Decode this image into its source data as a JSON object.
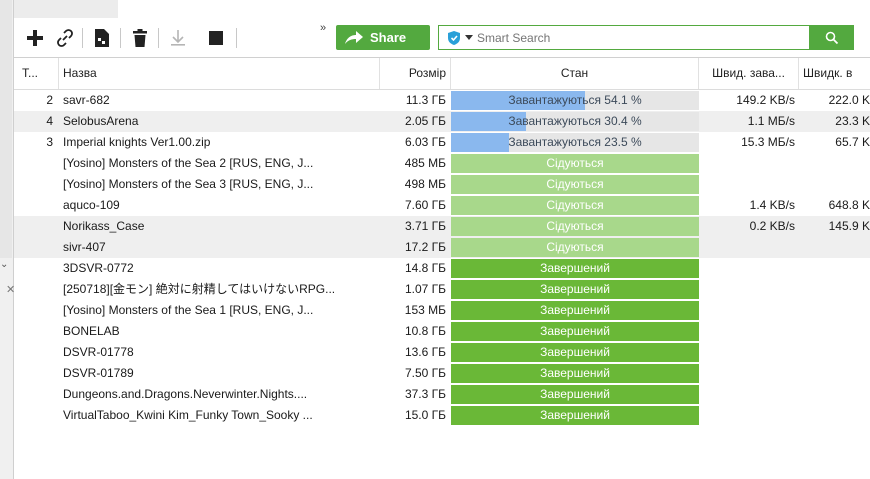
{
  "toolbar": {
    "share_label": "Share",
    "search_placeholder": "Smart Search",
    "overflow_label": "»"
  },
  "columns": {
    "num": "T...",
    "name": "Назва",
    "size": "Розмір",
    "status": "Стан",
    "down_speed": "Швид. зава...",
    "up_speed": "Швидк. в"
  },
  "rows": [
    {
      "num": "2",
      "name": "savr-682",
      "size": "11.3 ГБ",
      "status": "Завантажуються 54.1 %",
      "kind": "down",
      "progress": 0.541,
      "down": "149.2 KB/s",
      "up": "222.0 K"
    },
    {
      "num": "4",
      "name": "SelobusArena",
      "size": "2.05 ГБ",
      "status": "Завантажуються 30.4 %",
      "kind": "down",
      "progress": 0.304,
      "down": "1.1 МБ/s",
      "up": "23.3 K"
    },
    {
      "num": "3",
      "name": "Imperial knights Ver1.00.zip",
      "size": "6.03 ГБ",
      "status": "Завантажуються 23.5 %",
      "kind": "down",
      "progress": 0.235,
      "down": "15.3 МБ/s",
      "up": "65.7 K"
    },
    {
      "num": "",
      "name": "[Yosino] Monsters of the Sea 2 [RUS, ENG, J...",
      "size": "485 МБ",
      "status": "Сідуються",
      "kind": "seed",
      "progress": 1,
      "down": "",
      "up": ""
    },
    {
      "num": "",
      "name": "[Yosino] Monsters of the Sea 3 [RUS, ENG, J...",
      "size": "498 МБ",
      "status": "Сідуються",
      "kind": "seed",
      "progress": 1,
      "down": "",
      "up": ""
    },
    {
      "num": "",
      "name": "aquco-109",
      "size": "7.60 ГБ",
      "status": "Сідуються",
      "kind": "seed",
      "progress": 1,
      "down": "1.4 KB/s",
      "up": "648.8 K"
    },
    {
      "num": "",
      "name": "Norikass_Case",
      "size": "3.71 ГБ",
      "status": "Сідуються",
      "kind": "seed",
      "progress": 1,
      "down": "0.2 KB/s",
      "up": "145.9 K"
    },
    {
      "num": "",
      "name": "sivr-407",
      "size": "17.2 ГБ",
      "status": "Сідуються",
      "kind": "seed",
      "progress": 1,
      "down": "",
      "up": ""
    },
    {
      "num": "",
      "name": "3DSVR-0772",
      "size": "14.8 ГБ",
      "status": "Завершений",
      "kind": "done",
      "progress": 1,
      "down": "",
      "up": ""
    },
    {
      "num": "",
      "name": "[250718][金モン] 絶対に射精してはいけないRPG...",
      "size": "1.07 ГБ",
      "status": "Завершений",
      "kind": "done",
      "progress": 1,
      "down": "",
      "up": ""
    },
    {
      "num": "",
      "name": "[Yosino] Monsters of the Sea 1 [RUS, ENG, J...",
      "size": "153 МБ",
      "status": "Завершений",
      "kind": "done",
      "progress": 1,
      "down": "",
      "up": ""
    },
    {
      "num": "",
      "name": "BONELAB",
      "size": "10.8 ГБ",
      "status": "Завершений",
      "kind": "done",
      "progress": 1,
      "down": "",
      "up": ""
    },
    {
      "num": "",
      "name": "DSVR-01778",
      "size": "13.6 ГБ",
      "status": "Завершений",
      "kind": "done",
      "progress": 1,
      "down": "",
      "up": ""
    },
    {
      "num": "",
      "name": "DSVR-01789",
      "size": "7.50 ГБ",
      "status": "Завершений",
      "kind": "done",
      "progress": 1,
      "down": "",
      "up": ""
    },
    {
      "num": "",
      "name": "Dungeons.and.Dragons.Neverwinter.Nights....",
      "size": "37.3 ГБ",
      "status": "Завершений",
      "kind": "done",
      "progress": 1,
      "down": "",
      "up": ""
    },
    {
      "num": "",
      "name": "VirtualTaboo_Kwini Kim_Funky Town_Sooky ...",
      "size": "15.0 ГБ",
      "status": "Завершений",
      "kind": "done",
      "progress": 1,
      "down": "",
      "up": ""
    }
  ],
  "colors": {
    "accent": "#53a93f",
    "progress": "#8ab8ee",
    "seeding": "#a8d88b",
    "completed": "#6ab837"
  }
}
